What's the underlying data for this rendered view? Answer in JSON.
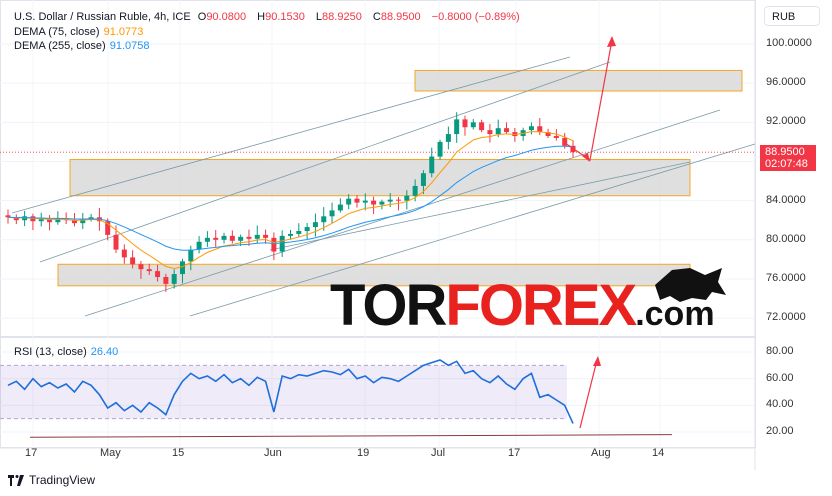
{
  "legend": {
    "symbol": "U.S. Dollar / Russian Ruble, 4h, ICE",
    "open_label": "O",
    "open": "90.0800",
    "high_label": "H",
    "high": "90.1530",
    "low_label": "L",
    "low": "88.9250",
    "close_label": "C",
    "close": "88.9500",
    "change": "−0.8000 (−0.89%)",
    "dema75_label": "DEMA (75, close)",
    "dema75": "91.0773",
    "dema255_label": "DEMA (255, close)",
    "dema255": "91.0758",
    "rsi_label": "RSI (13, close)",
    "rsi": "26.40"
  },
  "currency": "RUB",
  "price_tag": {
    "price": "88.9500",
    "countdown": "02:07:48"
  },
  "price_axis": [
    "100.0000",
    "96.0000",
    "92.0000",
    "84.0000",
    "80.0000",
    "76.0000",
    "72.0000"
  ],
  "rsi_axis": [
    "80.00",
    "60.00",
    "40.00",
    "20.00"
  ],
  "time_axis": [
    "17",
    "May",
    "15",
    "Jun",
    "19",
    "Jul",
    "17",
    "Aug",
    "14"
  ],
  "footer": "TradingView",
  "watermark": {
    "part1": "TOR",
    "part2": "FOREX",
    "part3": ".com"
  },
  "colors": {
    "up": "#089981",
    "down": "#f23645",
    "dema75": "#ff9800",
    "dema255": "#2196f3",
    "rsi": "#1e6fd9"
  },
  "chart_data": {
    "type": "candlestick",
    "title": "U.S. Dollar / Russian Ruble, 4h, ICE",
    "ylim": [
      70,
      102
    ],
    "closes": [
      82.3,
      82.0,
      82.4,
      81.9,
      82.1,
      81.8,
      82.2,
      82.0,
      81.7,
      82.1,
      82.3,
      81.9,
      80.5,
      79.0,
      78.2,
      77.5,
      77.0,
      76.8,
      76.2,
      75.5,
      76.5,
      77.8,
      79.0,
      79.8,
      80.2,
      80.0,
      80.4,
      79.9,
      80.3,
      80.1,
      80.5,
      80.2,
      78.8,
      80.4,
      80.6,
      80.9,
      81.3,
      81.8,
      82.4,
      83.0,
      83.6,
      84.2,
      83.8,
      84.0,
      83.6,
      83.9,
      84.1,
      84.0,
      84.5,
      85.5,
      86.8,
      88.5,
      90.0,
      90.8,
      92.3,
      91.5,
      92.0,
      91.2,
      90.8,
      91.4,
      91.0,
      90.6,
      91.2,
      91.6,
      91.0,
      90.6,
      90.4,
      89.6,
      88.95
    ],
    "rsi": {
      "ylim": [
        10,
        90
      ],
      "band": [
        30,
        70
      ],
      "values": [
        55,
        58,
        52,
        60,
        54,
        57,
        53,
        56,
        50,
        58,
        55,
        48,
        38,
        42,
        36,
        40,
        35,
        42,
        38,
        33,
        48,
        58,
        64,
        60,
        62,
        58,
        63,
        57,
        60,
        55,
        61,
        58,
        35,
        62,
        60,
        63,
        62,
        64,
        66,
        65,
        63,
        67,
        60,
        62,
        57,
        61,
        60,
        58,
        62,
        66,
        70,
        72,
        74,
        70,
        73,
        64,
        66,
        60,
        57,
        62,
        56,
        52,
        60,
        64,
        46,
        48,
        44,
        40,
        26.4
      ]
    },
    "zones": [
      {
        "from": 95.2,
        "to": 97.3
      },
      {
        "from": 84.5,
        "to": 88.2
      },
      {
        "from": 75.3,
        "to": 77.5
      }
    ]
  }
}
